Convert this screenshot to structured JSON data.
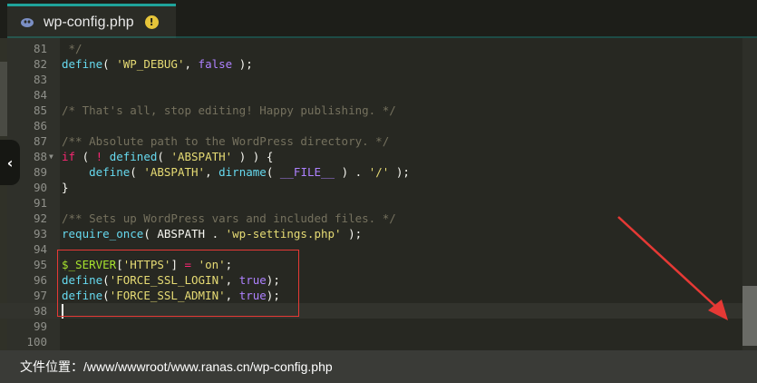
{
  "tab": {
    "title": "wp-config.php",
    "icon": "php-file-icon",
    "status_icon": "warning-icon",
    "status_glyph": "!"
  },
  "editor": {
    "lines": [
      {
        "n": "81",
        "tokens": [
          {
            "c": "t-cm",
            "t": " */"
          }
        ]
      },
      {
        "n": "82",
        "tokens": [
          {
            "c": "t-fn",
            "t": "define"
          },
          {
            "c": "t-tx",
            "t": "( "
          },
          {
            "c": "t-str",
            "t": "'WP_DEBUG'"
          },
          {
            "c": "t-tx",
            "t": ", "
          },
          {
            "c": "t-bool",
            "t": "false"
          },
          {
            "c": "t-tx",
            "t": " );"
          }
        ]
      },
      {
        "n": "83",
        "tokens": []
      },
      {
        "n": "84",
        "tokens": []
      },
      {
        "n": "85",
        "tokens": [
          {
            "c": "t-cm",
            "t": "/* That's all, stop editing! Happy publishing. */"
          }
        ]
      },
      {
        "n": "86",
        "tokens": []
      },
      {
        "n": "87",
        "tokens": [
          {
            "c": "t-cm",
            "t": "/** Absolute path to the WordPress directory. */"
          }
        ]
      },
      {
        "n": "88",
        "fold": true,
        "tokens": [
          {
            "c": "t-kw",
            "t": "if"
          },
          {
            "c": "t-tx",
            "t": " ( "
          },
          {
            "c": "t-kw",
            "t": "!"
          },
          {
            "c": "t-tx",
            "t": " "
          },
          {
            "c": "t-fn",
            "t": "defined"
          },
          {
            "c": "t-tx",
            "t": "( "
          },
          {
            "c": "t-str",
            "t": "'ABSPATH'"
          },
          {
            "c": "t-tx",
            "t": " ) ) {"
          }
        ]
      },
      {
        "n": "89",
        "tokens": [
          {
            "c": "t-tx",
            "t": "    "
          },
          {
            "c": "t-fn",
            "t": "define"
          },
          {
            "c": "t-tx",
            "t": "( "
          },
          {
            "c": "t-str",
            "t": "'ABSPATH'"
          },
          {
            "c": "t-tx",
            "t": ", "
          },
          {
            "c": "t-fn",
            "t": "dirname"
          },
          {
            "c": "t-tx",
            "t": "( "
          },
          {
            "c": "t-const",
            "t": "__FILE__"
          },
          {
            "c": "t-tx",
            "t": " ) . "
          },
          {
            "c": "t-str",
            "t": "'/'"
          },
          {
            "c": "t-tx",
            "t": " );"
          }
        ]
      },
      {
        "n": "90",
        "tokens": [
          {
            "c": "t-tx",
            "t": "}"
          }
        ]
      },
      {
        "n": "91",
        "tokens": []
      },
      {
        "n": "92",
        "tokens": [
          {
            "c": "t-cm",
            "t": "/** Sets up WordPress vars and included files. */"
          }
        ]
      },
      {
        "n": "93",
        "tokens": [
          {
            "c": "t-fn",
            "t": "require_once"
          },
          {
            "c": "t-tx",
            "t": "( ABSPATH . "
          },
          {
            "c": "t-str",
            "t": "'wp-settings.php'"
          },
          {
            "c": "t-tx",
            "t": " );"
          }
        ]
      },
      {
        "n": "94",
        "tokens": []
      },
      {
        "n": "95",
        "tokens": [
          {
            "c": "t-var",
            "t": "$_SERVER"
          },
          {
            "c": "t-tx",
            "t": "["
          },
          {
            "c": "t-str",
            "t": "'HTTPS'"
          },
          {
            "c": "t-tx",
            "t": "] "
          },
          {
            "c": "t-kw",
            "t": "="
          },
          {
            "c": "t-tx",
            "t": " "
          },
          {
            "c": "t-str",
            "t": "'on'"
          },
          {
            "c": "t-tx",
            "t": ";"
          }
        ]
      },
      {
        "n": "96",
        "tokens": [
          {
            "c": "t-fn",
            "t": "define"
          },
          {
            "c": "t-tx",
            "t": "("
          },
          {
            "c": "t-str",
            "t": "'FORCE_SSL_LOGIN'"
          },
          {
            "c": "t-tx",
            "t": ", "
          },
          {
            "c": "t-bool",
            "t": "true"
          },
          {
            "c": "t-tx",
            "t": ");"
          }
        ]
      },
      {
        "n": "97",
        "tokens": [
          {
            "c": "t-fn",
            "t": "define"
          },
          {
            "c": "t-tx",
            "t": "("
          },
          {
            "c": "t-str",
            "t": "'FORCE_SSL_ADMIN'"
          },
          {
            "c": "t-tx",
            "t": ", "
          },
          {
            "c": "t-bool",
            "t": "true"
          },
          {
            "c": "t-tx",
            "t": ");"
          }
        ]
      },
      {
        "n": "98",
        "active": true,
        "tokens": []
      },
      {
        "n": "99",
        "tokens": []
      },
      {
        "n": "100",
        "tokens": []
      }
    ]
  },
  "statusbar": {
    "label": "文件位置：",
    "path": "/www/wwwroot/www.ranas.cn/wp-config.php"
  },
  "colors": {
    "accent": "#1fa39a",
    "annotation": "#e53935",
    "warning": "#e6c53a"
  }
}
